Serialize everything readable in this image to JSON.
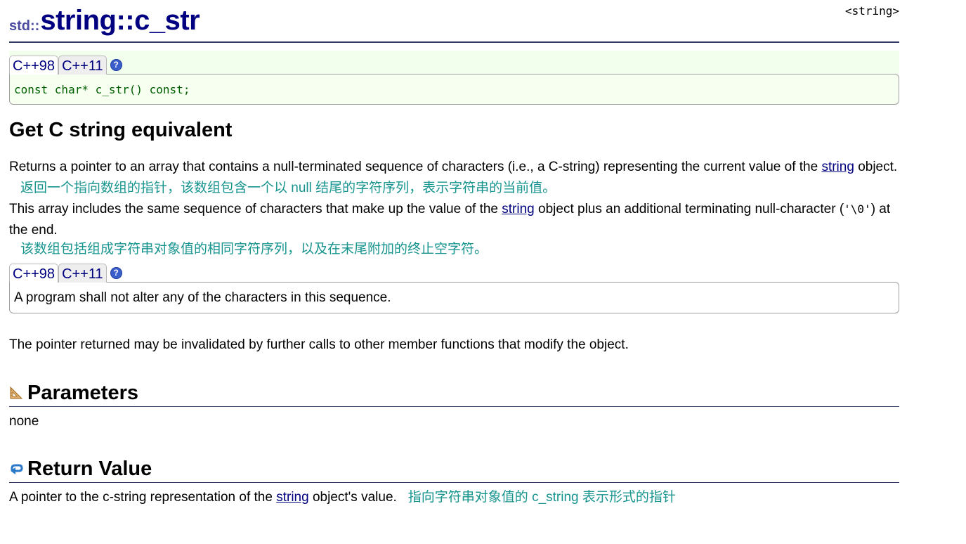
{
  "header": {
    "tag": "<string>",
    "namespace": "std::",
    "title": "string::c_str"
  },
  "tabs": [
    "C++98",
    "C++11"
  ],
  "help_icon_glyph": "?",
  "prototype": "const char* c_str() const;",
  "heading": "Get C string equivalent",
  "para1": {
    "before": "Returns a pointer to an array that contains a null-terminated sequence of characters (i.e., a C-string) representing the current value of the ",
    "link": "string",
    "after": " object."
  },
  "para1_cn": "返回一个指向数组的指针，该数组包含一个以 null 结尾的字符序列，表示字符串的当前值。",
  "para2": {
    "before": "This array includes the same sequence of characters that make up the value of the ",
    "link": "string",
    "after": " object plus an additional terminating null-character (",
    "code": "'\\0'",
    "end": ") at the end."
  },
  "para2_cn": "该数组包括组成字符串对象值的相同字符序列，以及在末尾附加的终止空字符。",
  "note": "A program shall not alter any of the characters in this sequence.",
  "para3": "The pointer returned may be invalidated by further calls to other member functions that modify the object.",
  "parameters": {
    "heading": "Parameters",
    "icon": "triangle-ruler-icon",
    "body": "none"
  },
  "return_value": {
    "heading": "Return Value",
    "icon": "return-arrow-icon",
    "before": "A pointer to the c-string representation of the ",
    "link": "string",
    "after": " object's value.",
    "cn": "指向字符串对象值的 c_string 表示形式的指针"
  },
  "colors": {
    "title": "#000080",
    "link": "#000080",
    "chinese": "#17948e",
    "code": "#006000",
    "rule": "#303c64"
  }
}
